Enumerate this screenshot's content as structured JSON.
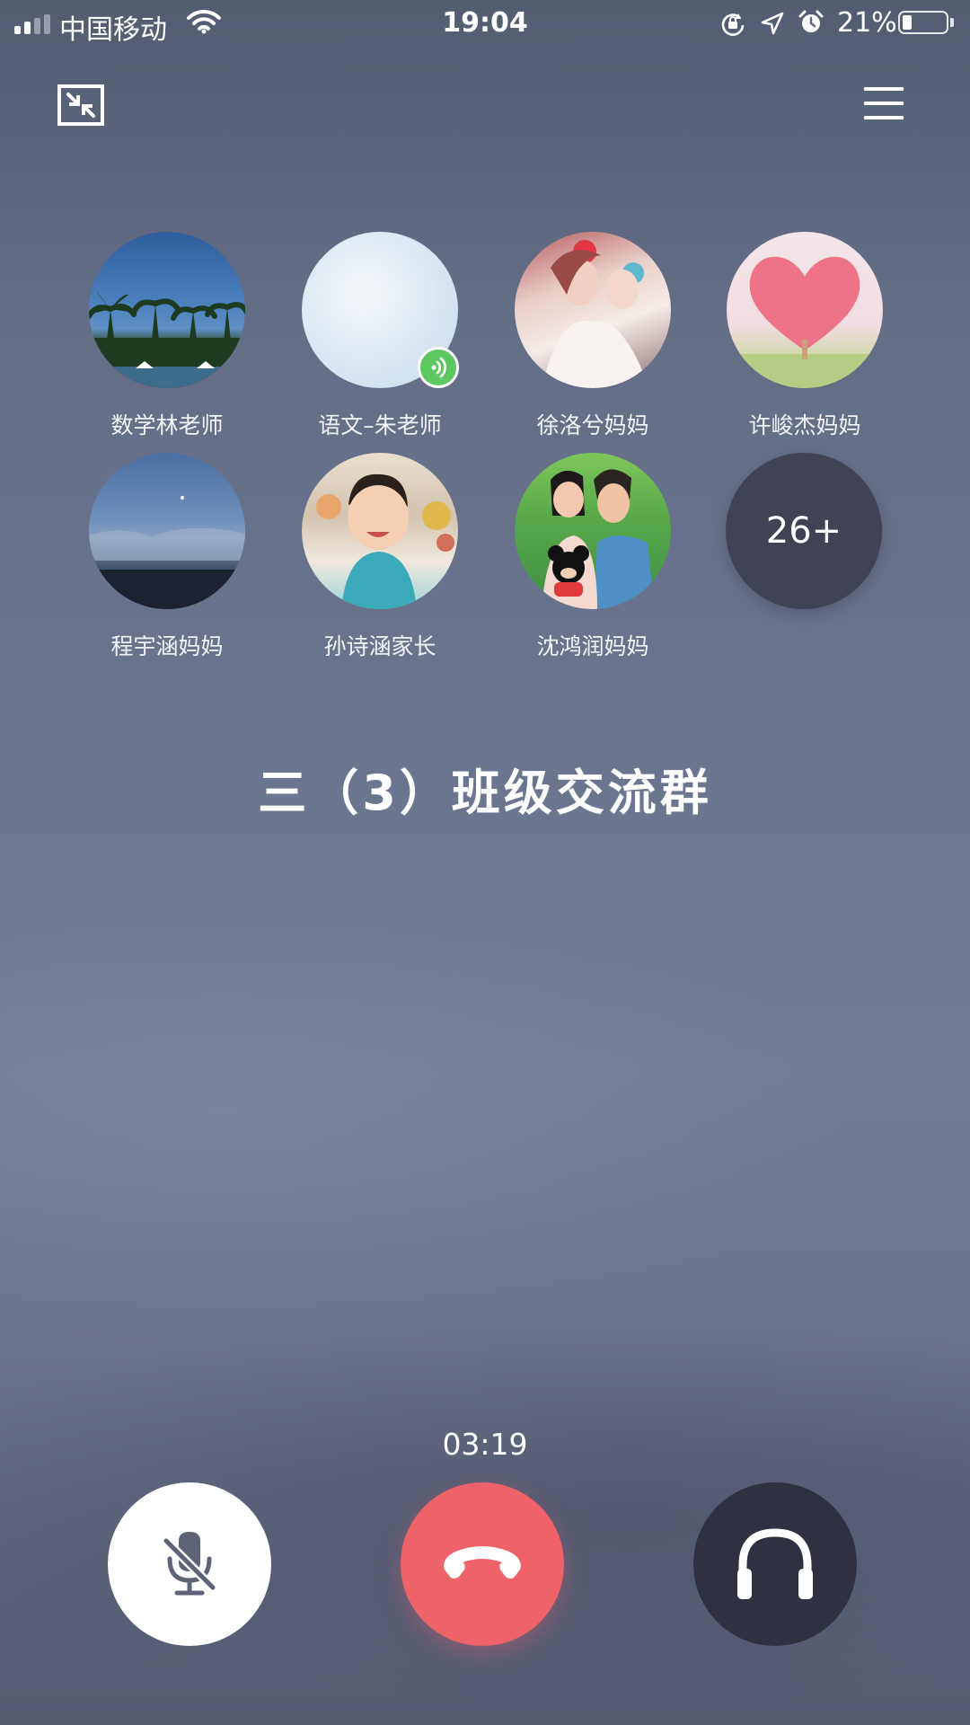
{
  "status_bar": {
    "carrier": "中国移动",
    "time": "19:04",
    "battery_percent": "21%",
    "battery_level": 0.21,
    "signal_bars": 2,
    "icons": [
      "signal-icon",
      "wifi-icon",
      "orientation-lock-icon",
      "location-icon",
      "alarm-icon",
      "battery-icon"
    ]
  },
  "toolbar": {
    "minimize_icon": "minimize-icon",
    "menu_icon": "menu-icon"
  },
  "participants": [
    {
      "name": "数学林老师",
      "avatar": "palm-trees-photo",
      "speaking": false
    },
    {
      "name": "语文–朱老师",
      "avatar": "pale-sky-photo",
      "speaking": true
    },
    {
      "name": "徐洛兮妈妈",
      "avatar": "couple-photo",
      "speaking": false
    },
    {
      "name": "许峻杰妈妈",
      "avatar": "pink-heart-photo",
      "speaking": false
    },
    {
      "name": "程宇涵妈妈",
      "avatar": "dusk-sky-photo",
      "speaking": false
    },
    {
      "name": "孙诗涵家长",
      "avatar": "baby-photo",
      "speaking": false
    },
    {
      "name": "沈鸿润妈妈",
      "avatar": "couple-green-photo",
      "speaking": false
    }
  ],
  "more_count": "26+",
  "group_name": "三（3）班级交流群",
  "call": {
    "duration": "03:19",
    "buttons": [
      {
        "name": "mute",
        "icon": "microphone-off-icon",
        "color": "#ffffff"
      },
      {
        "name": "hang-up",
        "icon": "phone-hangup-icon",
        "color": "#ee6269"
      },
      {
        "name": "speaker",
        "icon": "headphones-icon",
        "color": "#2f3140"
      }
    ]
  },
  "colors": {
    "speaking_badge": "#5cc85f",
    "hangup": "#ee6269",
    "more_bubble": "#3f4354"
  }
}
